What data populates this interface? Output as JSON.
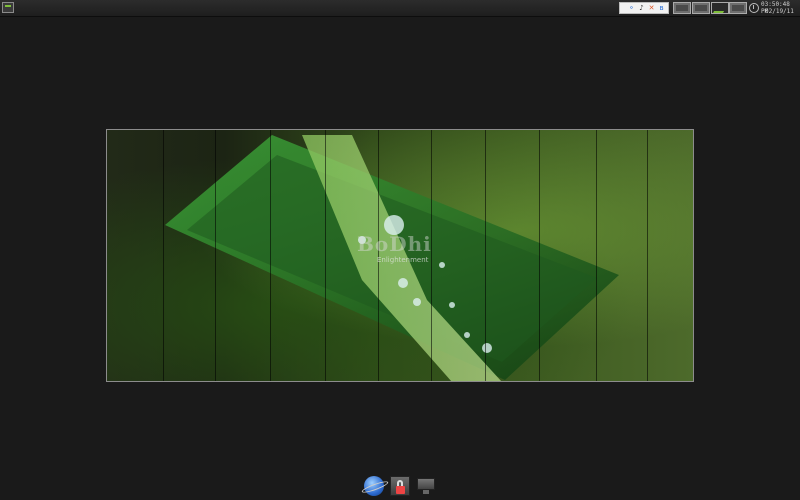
{
  "panel": {
    "clock": {
      "time": "03:50:48 PM",
      "date": "02/19/11"
    }
  },
  "wallpaper": {
    "logo_text": "BoDhi",
    "logo_subtitle": "Enlightenment"
  },
  "dock": {
    "items": [
      "web-browser",
      "security-lock",
      "display-monitor"
    ]
  },
  "colors": {
    "panel_bg": "#2c2c2c",
    "desktop_bg": "#1a1a1a",
    "accent_green": "#7fbf3a"
  }
}
